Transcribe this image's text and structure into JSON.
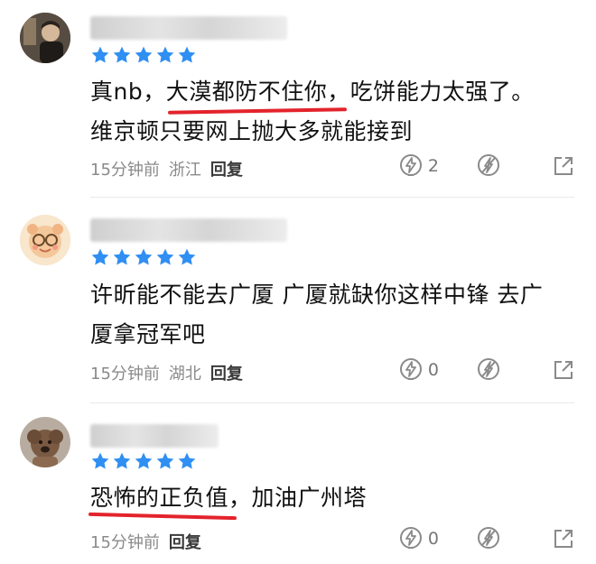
{
  "comments": [
    {
      "text_line1": "真nb，大漠都防不住你，吃饼能力太强了。",
      "text_line2": "维京顿只要网上抛大多就能接到",
      "time": "15分钟前",
      "location": "浙江",
      "reply_label": "回复",
      "like_count": "2"
    },
    {
      "text_line1": "许昕能不能去广厦 广厦就缺你这样中锋 去广",
      "text_line2": "厦拿冠军吧",
      "time": "15分钟前",
      "location": "湖北",
      "reply_label": "回复",
      "like_count": "0"
    },
    {
      "text_line1": "恐怖的正负值，加油广州塔",
      "time": "15分钟前",
      "reply_label": "回复",
      "like_count": "0"
    }
  ],
  "rating_stars": 5,
  "colors": {
    "star": "#2f8ff3",
    "underline": "#e3232c",
    "meta": "#8a8a8a"
  }
}
